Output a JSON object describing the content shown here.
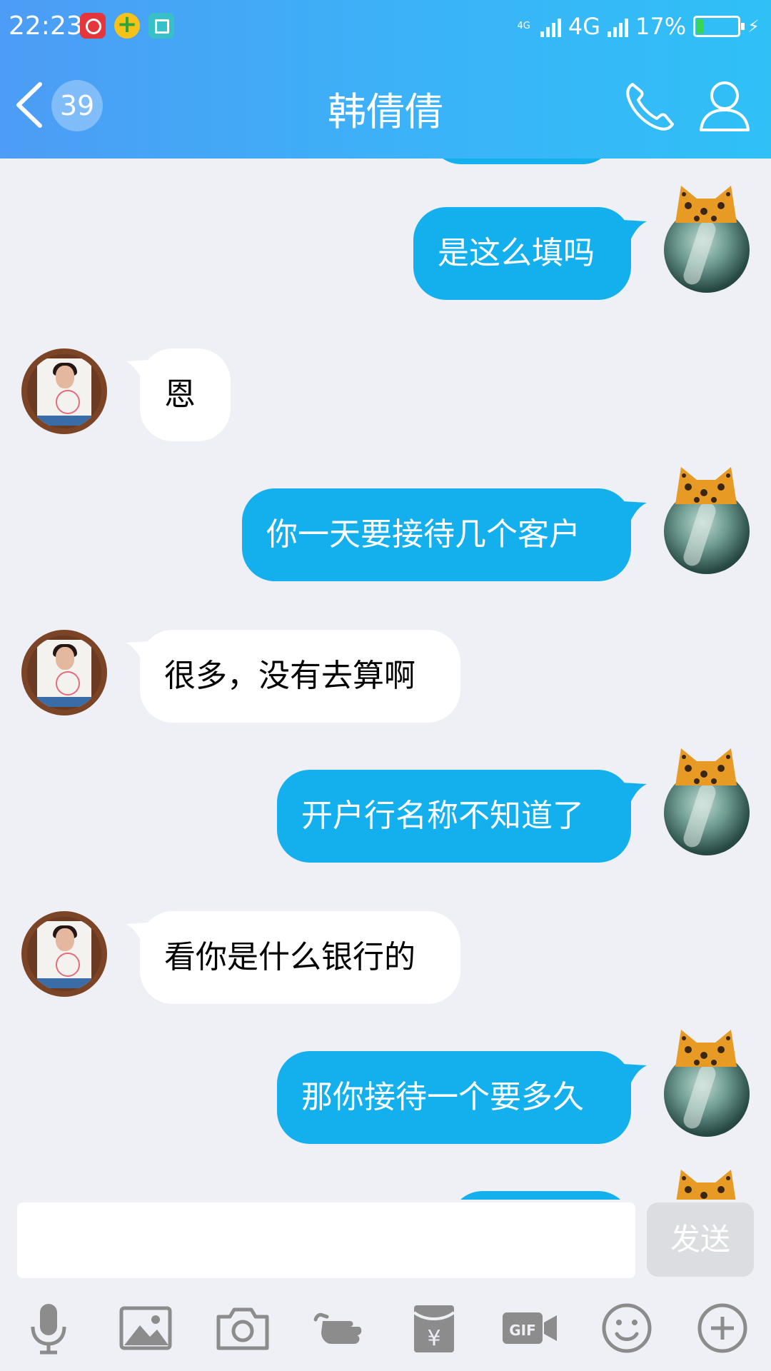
{
  "status_bar": {
    "time": "22:23",
    "network_small": "4G",
    "network": "4G",
    "battery": "17%",
    "battery_level": 0.17,
    "app_icons": [
      "netease-music-icon",
      "360-security-icon",
      "scanner-icon"
    ]
  },
  "header": {
    "unread_count": "39",
    "title": "韩倩倩",
    "icons": [
      "back-chevron-icon",
      "phone-icon",
      "profile-icon"
    ]
  },
  "messages": [
    {
      "from": "me",
      "text": "是这么填吗"
    },
    {
      "from": "other",
      "text": "恩"
    },
    {
      "from": "me",
      "text": "你一天要接待几个客户"
    },
    {
      "from": "other",
      "text": "很多，没有去算啊"
    },
    {
      "from": "me",
      "text": "开户行名称不知道了"
    },
    {
      "from": "other",
      "text": "看你是什么银行的"
    },
    {
      "from": "me",
      "text": "那你接待一个要多久"
    }
  ],
  "input": {
    "value": "",
    "send_label": "发送"
  },
  "toolbar": {
    "gif_label": "GIF",
    "yen_label": "¥",
    "icons": [
      "microphone-icon",
      "image-icon",
      "camera-icon",
      "poke-hand-icon",
      "red-packet-icon",
      "gif-video-icon",
      "emoji-icon",
      "plus-icon"
    ]
  },
  "colors": {
    "header_start": "#4d9cf5",
    "header_end": "#2fc0f6",
    "outgoing_bubble": "#14b0ee",
    "incoming_bubble": "#ffffff",
    "background": "#eef0f6",
    "icon_gray": "#8c8c8c"
  }
}
